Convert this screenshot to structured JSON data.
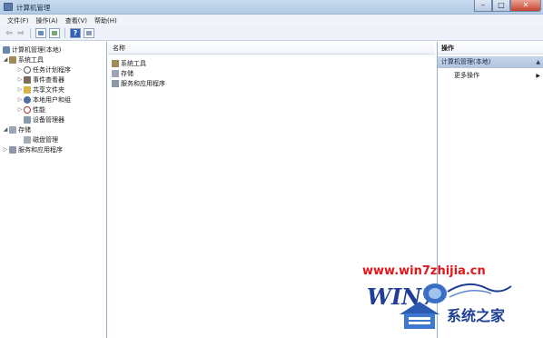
{
  "window": {
    "title": "计算机管理",
    "controls": {
      "minimize": "–",
      "maximize": "□",
      "close": "✕"
    }
  },
  "menu": [
    "文件(F)",
    "操作(A)",
    "查看(V)",
    "帮助(H)"
  ],
  "toolbar": {
    "back": "⇦",
    "forward": "⇨",
    "help": "?"
  },
  "tree": {
    "root": "计算机管理(本地)",
    "items": [
      {
        "label": "系统工具",
        "expander": "◢",
        "icon": "tools-icon"
      },
      {
        "label": "任务计划程序",
        "expander": "▷",
        "icon": "clock-icon"
      },
      {
        "label": "事件查看器",
        "expander": "▷",
        "icon": "event-viewer-icon"
      },
      {
        "label": "共享文件夹",
        "expander": "▷",
        "icon": "shared-folder-icon"
      },
      {
        "label": "本地用户和组",
        "expander": "▷",
        "icon": "users-icon"
      },
      {
        "label": "性能",
        "expander": "▷",
        "icon": "performance-icon"
      },
      {
        "label": "设备管理器",
        "expander": "",
        "icon": "device-manager-icon"
      },
      {
        "label": "存储",
        "expander": "◢",
        "icon": "storage-icon"
      },
      {
        "label": "磁盘管理",
        "expander": "",
        "icon": "disk-icon"
      },
      {
        "label": "服务和应用程序",
        "expander": "▷",
        "icon": "services-icon"
      }
    ]
  },
  "center": {
    "column_header": "名称",
    "rows": [
      {
        "label": "系统工具",
        "icon": "tools-icon"
      },
      {
        "label": "存储",
        "icon": "storage-icon"
      },
      {
        "label": "服务和应用程序",
        "icon": "services-icon"
      }
    ]
  },
  "actions": {
    "header": "操作",
    "section": "计算机管理(本地)",
    "more": "更多操作",
    "arrow_up": "▲",
    "arrow_right": "▶"
  },
  "watermark": {
    "url": "www.win7zhijia.cn",
    "logo_word": "WIN7",
    "brand": "系统之家"
  },
  "colors": {
    "titlebar": "#c6d9ee",
    "actions_section": "#c8d6ea",
    "watermark_red": "#e0161b",
    "watermark_blue": "#1f3f96"
  }
}
